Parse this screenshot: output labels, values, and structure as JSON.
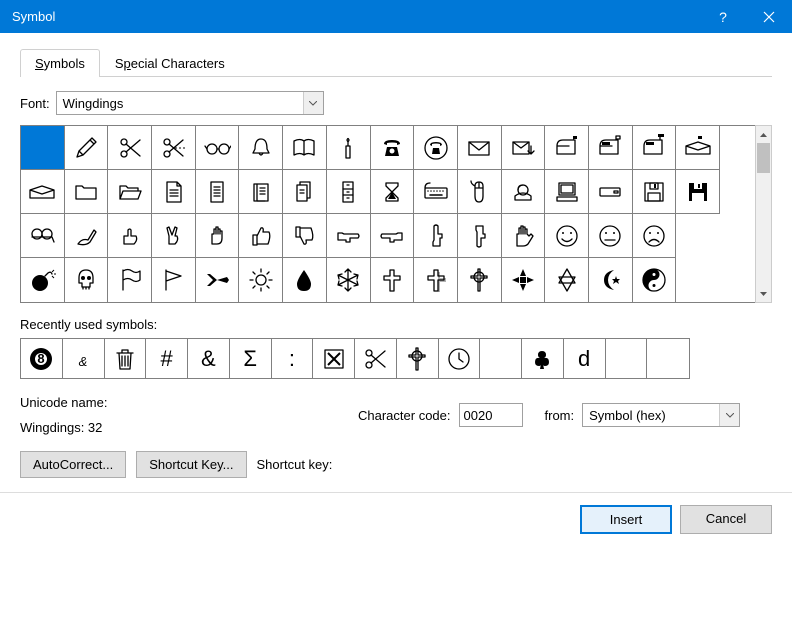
{
  "title": "Symbol",
  "tabs": {
    "symbols": "Symbols",
    "special": "Special Characters"
  },
  "labels": {
    "font": "Font:",
    "recent": "Recently used symbols:",
    "unicode_name": "Unicode name:",
    "unicode_value": "Wingdings: 32",
    "char_code": "Character code:",
    "from": "from:",
    "shortcut_key": "Shortcut key:"
  },
  "font_value": "Wingdings",
  "char_code_value": "0020",
  "from_value": "Symbol (hex)",
  "buttons": {
    "autocorrect": "AutoCorrect...",
    "shortcut": "Shortcut Key...",
    "insert": "Insert",
    "cancel": "Cancel"
  },
  "symbols": [
    [
      " ",
      "pencil",
      "scissors",
      "scissors-cut",
      "glasses",
      "bell",
      "book",
      "candle",
      "phone",
      "phone-circle",
      "envelope",
      "envelope-arrow",
      "mailbox-closed",
      "mailbox-open",
      "mailbox-out",
      "mailbox-full"
    ],
    [
      "inbox",
      "folder",
      "folder-open",
      "document",
      "page",
      "pages",
      "documents",
      "cabinet",
      "hourglass",
      "keyboard",
      "mouse",
      "trackball",
      "computer",
      "harddisk",
      "floppy",
      "floppy-black"
    ],
    [
      "tape",
      "hand-write",
      "hand-ok",
      "hand-victory",
      "hand",
      "thumbs-up",
      "thumbs-down",
      "point-right",
      "point-left",
      "point-up",
      "point-down",
      "hand-stop",
      "face-smile",
      "face-neutral",
      "face-sad"
    ],
    [
      "bomb",
      "skull",
      "flag",
      "pennant",
      "airplane",
      "sun",
      "droplet",
      "snowflake",
      "cross",
      "cross-shadow",
      "celtic-cross",
      "maltese-cross",
      "star-david",
      "crescent",
      "yin-yang"
    ]
  ],
  "recent": [
    "eight-ball",
    "ampersand-script",
    "trash",
    "#",
    "&",
    "Σ",
    ":",
    "x-box",
    "scissors",
    "celtic-cross",
    "clock",
    " ",
    "club",
    "d",
    " ",
    " "
  ]
}
